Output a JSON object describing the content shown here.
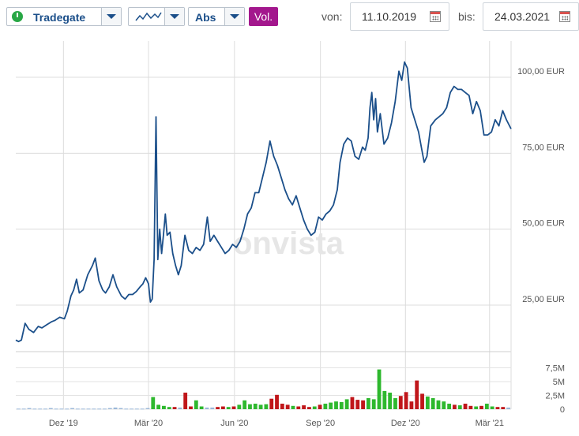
{
  "toolbar": {
    "exchange": "Tradegate",
    "chart_style_icon": "line-chart-icon",
    "scale": "Abs",
    "volume_label": "Vol.",
    "from_label": "von:",
    "from_date": "11.10.2019",
    "to_label": "bis:",
    "to_date": "24.03.2021",
    "calendar_icon": "calendar-icon"
  },
  "watermark": "onvista",
  "colors": {
    "line": "#1b4f8a",
    "volume_up": "#2eb82e",
    "volume_down": "#c0161a",
    "volume_flat": "#9ab7d8",
    "vol_button": "#a3178d"
  },
  "chart_data": [
    {
      "type": "line",
      "title": "",
      "ylabel": "",
      "ylim": [
        0,
        105
      ],
      "yticks": [
        {
          "value": 25,
          "label": "25,00 EUR"
        },
        {
          "value": 50,
          "label": "50,00 EUR"
        },
        {
          "value": 75,
          "label": "75,00 EUR"
        },
        {
          "value": 100,
          "label": "100,00 EUR"
        }
      ],
      "xticks": [
        {
          "x": "2019-12-01",
          "label": "Dez '19"
        },
        {
          "x": "2020-03-01",
          "label": "Mär '20"
        },
        {
          "x": "2020-06-01",
          "label": "Jun '20"
        },
        {
          "x": "2020-09-01",
          "label": "Sep '20"
        },
        {
          "x": "2020-12-01",
          "label": "Dez '20"
        },
        {
          "x": "2021-03-01",
          "label": "Mär '21"
        }
      ],
      "xlim": [
        "2019-10-11",
        "2021-03-24"
      ],
      "grid": true,
      "series": [
        {
          "points": [
            [
              "2019-10-11",
              13.5
            ],
            [
              "2019-10-14",
              13
            ],
            [
              "2019-10-17",
              13.5
            ],
            [
              "2019-10-21",
              19
            ],
            [
              "2019-10-25",
              17
            ],
            [
              "2019-10-30",
              16
            ],
            [
              "2019-11-04",
              18
            ],
            [
              "2019-11-08",
              17.5
            ],
            [
              "2019-11-13",
              18.5
            ],
            [
              "2019-11-18",
              19.5
            ],
            [
              "2019-11-22",
              20
            ],
            [
              "2019-11-27",
              21
            ],
            [
              "2019-12-02",
              20.5
            ],
            [
              "2019-12-05",
              23
            ],
            [
              "2019-12-09",
              28
            ],
            [
              "2019-12-12",
              30
            ],
            [
              "2019-12-15",
              33.5
            ],
            [
              "2019-12-18",
              29
            ],
            [
              "2019-12-22",
              30
            ],
            [
              "2019-12-27",
              35
            ],
            [
              "2020-01-01",
              38
            ],
            [
              "2020-01-04",
              40.5
            ],
            [
              "2020-01-08",
              33
            ],
            [
              "2020-01-12",
              30
            ],
            [
              "2020-01-15",
              29
            ],
            [
              "2020-01-19",
              31
            ],
            [
              "2020-01-23",
              35
            ],
            [
              "2020-01-27",
              31
            ],
            [
              "2020-02-01",
              28
            ],
            [
              "2020-02-05",
              27
            ],
            [
              "2020-02-09",
              28.5
            ],
            [
              "2020-02-13",
              28.5
            ],
            [
              "2020-02-17",
              29.5
            ],
            [
              "2020-02-21",
              31
            ],
            [
              "2020-02-24",
              32
            ],
            [
              "2020-02-27",
              34
            ],
            [
              "2020-03-01",
              32
            ],
            [
              "2020-03-03",
              26
            ],
            [
              "2020-03-05",
              27
            ],
            [
              "2020-03-07",
              40
            ],
            [
              "2020-03-09",
              87
            ],
            [
              "2020-03-11",
              40
            ],
            [
              "2020-03-13",
              50
            ],
            [
              "2020-03-15",
              42
            ],
            [
              "2020-03-17",
              48
            ],
            [
              "2020-03-19",
              55
            ],
            [
              "2020-03-21",
              48
            ],
            [
              "2020-03-24",
              49
            ],
            [
              "2020-03-27",
              42
            ],
            [
              "2020-03-30",
              38
            ],
            [
              "2020-04-02",
              35
            ],
            [
              "2020-04-05",
              38
            ],
            [
              "2020-04-09",
              48
            ],
            [
              "2020-04-13",
              43
            ],
            [
              "2020-04-17",
              42
            ],
            [
              "2020-04-21",
              44
            ],
            [
              "2020-04-25",
              43
            ],
            [
              "2020-04-29",
              45
            ],
            [
              "2020-05-03",
              54
            ],
            [
              "2020-05-06",
              46
            ],
            [
              "2020-05-10",
              48
            ],
            [
              "2020-05-14",
              46
            ],
            [
              "2020-05-18",
              44
            ],
            [
              "2020-05-22",
              42
            ],
            [
              "2020-05-26",
              43
            ],
            [
              "2020-05-30",
              45
            ],
            [
              "2020-06-03",
              44
            ],
            [
              "2020-06-07",
              46
            ],
            [
              "2020-06-11",
              50
            ],
            [
              "2020-06-15",
              55
            ],
            [
              "2020-06-19",
              57
            ],
            [
              "2020-06-23",
              62
            ],
            [
              "2020-06-27",
              62
            ],
            [
              "2020-07-01",
              67
            ],
            [
              "2020-07-05",
              72
            ],
            [
              "2020-07-09",
              79
            ],
            [
              "2020-07-13",
              74
            ],
            [
              "2020-07-17",
              71
            ],
            [
              "2020-07-21",
              67
            ],
            [
              "2020-07-25",
              63
            ],
            [
              "2020-07-29",
              60
            ],
            [
              "2020-08-02",
              58
            ],
            [
              "2020-08-06",
              61
            ],
            [
              "2020-08-10",
              57
            ],
            [
              "2020-08-14",
              53
            ],
            [
              "2020-08-18",
              50
            ],
            [
              "2020-08-22",
              48
            ],
            [
              "2020-08-26",
              49
            ],
            [
              "2020-08-30",
              54
            ],
            [
              "2020-09-03",
              53
            ],
            [
              "2020-09-07",
              55
            ],
            [
              "2020-09-11",
              56
            ],
            [
              "2020-09-15",
              58
            ],
            [
              "2020-09-19",
              63
            ],
            [
              "2020-09-22",
              72
            ],
            [
              "2020-09-26",
              78
            ],
            [
              "2020-09-30",
              80
            ],
            [
              "2020-10-04",
              79
            ],
            [
              "2020-10-08",
              74
            ],
            [
              "2020-10-12",
              73
            ],
            [
              "2020-10-16",
              77
            ],
            [
              "2020-10-19",
              76
            ],
            [
              "2020-10-22",
              80
            ],
            [
              "2020-10-24",
              90
            ],
            [
              "2020-10-26",
              95
            ],
            [
              "2020-10-28",
              86
            ],
            [
              "2020-10-30",
              93
            ],
            [
              "2020-11-01",
              82
            ],
            [
              "2020-11-04",
              88
            ],
            [
              "2020-11-08",
              78
            ],
            [
              "2020-11-12",
              80
            ],
            [
              "2020-11-16",
              85
            ],
            [
              "2020-11-20",
              92
            ],
            [
              "2020-11-24",
              102
            ],
            [
              "2020-11-27",
              99
            ],
            [
              "2020-11-30",
              105
            ],
            [
              "2020-12-03",
              103
            ],
            [
              "2020-12-07",
              90
            ],
            [
              "2020-12-11",
              86
            ],
            [
              "2020-12-15",
              82
            ],
            [
              "2020-12-18",
              77
            ],
            [
              "2020-12-21",
              72
            ],
            [
              "2020-12-24",
              74
            ],
            [
              "2020-12-28",
              84
            ],
            [
              "2021-01-02",
              86
            ],
            [
              "2021-01-06",
              87
            ],
            [
              "2021-01-10",
              88
            ],
            [
              "2021-01-14",
              90
            ],
            [
              "2021-01-18",
              95
            ],
            [
              "2021-01-22",
              97
            ],
            [
              "2021-01-26",
              96
            ],
            [
              "2021-01-30",
              96
            ],
            [
              "2021-02-03",
              95
            ],
            [
              "2021-02-07",
              94
            ],
            [
              "2021-02-11",
              88
            ],
            [
              "2021-02-15",
              92
            ],
            [
              "2021-02-19",
              89
            ],
            [
              "2021-02-23",
              81
            ],
            [
              "2021-02-27",
              81
            ],
            [
              "2021-03-03",
              82
            ],
            [
              "2021-03-07",
              86
            ],
            [
              "2021-03-11",
              84
            ],
            [
              "2021-03-15",
              89
            ],
            [
              "2021-03-19",
              86
            ],
            [
              "2021-03-24",
              83
            ]
          ]
        }
      ]
    },
    {
      "type": "bar",
      "title": "",
      "ylabel": "",
      "ylim": [
        0,
        10
      ],
      "yticks": [
        {
          "value": 0,
          "label": "0"
        },
        {
          "value": 2.5,
          "label": "2,5M"
        },
        {
          "value": 5,
          "label": "5M"
        },
        {
          "value": 7.5,
          "label": "7,5M"
        }
      ],
      "volume_millions_by_week": [
        0.1,
        0.1,
        0.2,
        0.1,
        0.1,
        0.1,
        0.2,
        0.1,
        0.1,
        0.1,
        0.2,
        0.1,
        0.1,
        0.1,
        0.1,
        0.1,
        0.1,
        0.2,
        0.3,
        0.2,
        0.1,
        0.1,
        0.1,
        0.1,
        0.2,
        2.2,
        0.8,
        0.6,
        0.4,
        0.4,
        0.3,
        3.0,
        0.5,
        1.6,
        0.5,
        0.3,
        0.3,
        0.4,
        0.5,
        0.4,
        0.5,
        0.8,
        1.6,
        0.9,
        1.0,
        0.8,
        0.9,
        1.9,
        2.6,
        1.0,
        0.8,
        0.6,
        0.5,
        0.7,
        0.4,
        0.5,
        0.8,
        1.0,
        1.2,
        1.4,
        1.3,
        1.8,
        2.2,
        1.7,
        1.6,
        2.0,
        1.8,
        7.2,
        3.3,
        3.0,
        2.0,
        2.4,
        3.1,
        1.4,
        5.2,
        2.8,
        2.3,
        2.0,
        1.6,
        1.4,
        1.0,
        0.8,
        0.7,
        1.0,
        0.6,
        0.5,
        0.6,
        1.0,
        0.5,
        0.4,
        0.4,
        0.3
      ]
    }
  ],
  "volume_xticks": [
    "Dez '19",
    "Mär '20",
    "Jun '20",
    "Sep '20",
    "Dez '20",
    "Mär '21"
  ]
}
